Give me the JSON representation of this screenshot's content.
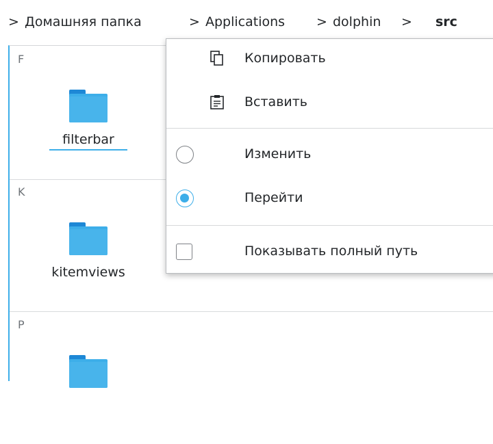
{
  "breadcrumb": {
    "items": [
      "Домашняя папка",
      "Applications",
      "dolphin",
      "src"
    ],
    "separator": ">"
  },
  "groups": [
    {
      "letter": "F",
      "items": [
        {
          "name": "filterbar",
          "focused": true
        }
      ]
    },
    {
      "letter": "K",
      "items": [
        {
          "name": "kitemviews",
          "focused": false
        }
      ]
    },
    {
      "letter": "P",
      "items": []
    }
  ],
  "menu": {
    "copy": {
      "label": "Копировать",
      "icon": "copy-icon"
    },
    "paste": {
      "label": "Вставить",
      "icon": "paste-icon"
    },
    "edit": {
      "label": "Изменить",
      "checked": false
    },
    "goto": {
      "label": "Перейти",
      "checked": true
    },
    "show_full_path": {
      "label": "Показывать полный путь",
      "checked": false
    }
  },
  "colors": {
    "accent": "#3daee9",
    "folder": "#3daee9",
    "text": "#232629"
  }
}
